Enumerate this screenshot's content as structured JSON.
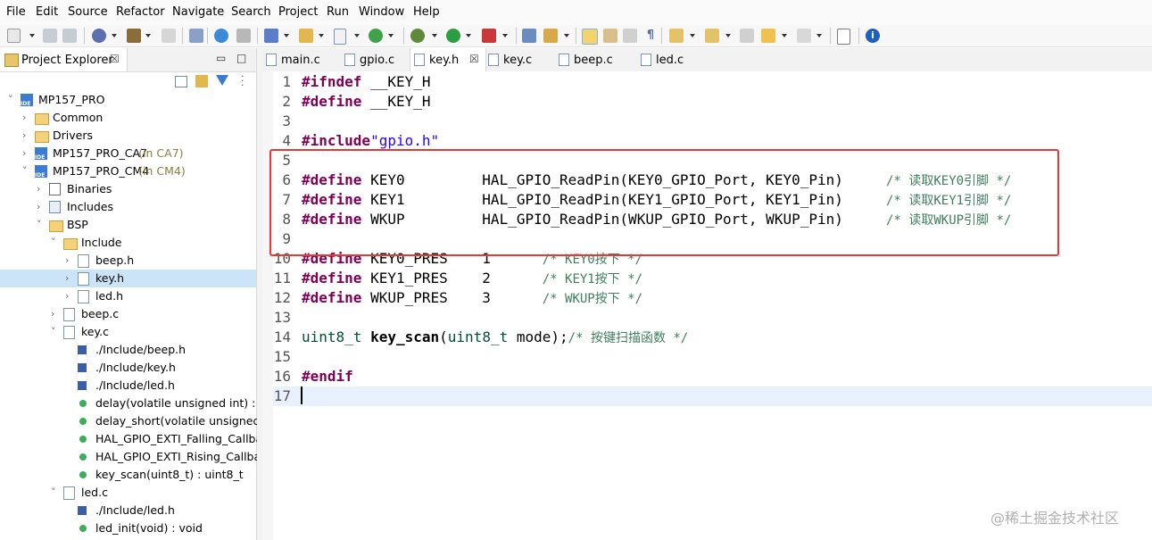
{
  "menubar": [
    "File",
    "Edit",
    "Source",
    "Refactor",
    "Navigate",
    "Search",
    "Project",
    "Run",
    "Window",
    "Help"
  ],
  "explorer": {
    "title": "Project Explorer",
    "tab_close": "☒",
    "minimize": "▭",
    "maximize": "□",
    "tree": [
      {
        "label": "MP157_PRO",
        "suffix": "",
        "icon": "proj",
        "twisty": "˅"
      },
      {
        "label": "Common",
        "suffix": "",
        "icon": "folder",
        "twisty": "›"
      },
      {
        "label": "Drivers",
        "suffix": "",
        "icon": "folder",
        "twisty": "›"
      },
      {
        "label": "MP157_PRO_CA7",
        "suffix": " (in CA7)",
        "icon": "proj",
        "twisty": "›"
      },
      {
        "label": "MP157_PRO_CM4",
        "suffix": " (in CM4)",
        "icon": "proj",
        "twisty": "˅"
      },
      {
        "label": "Binaries",
        "suffix": "",
        "icon": "bin",
        "twisty": "›"
      },
      {
        "label": "Includes",
        "suffix": "",
        "icon": "incl",
        "twisty": "›"
      },
      {
        "label": "BSP",
        "suffix": "",
        "icon": "folder",
        "twisty": "˅"
      },
      {
        "label": "Include",
        "suffix": "",
        "icon": "folder",
        "twisty": "˅"
      },
      {
        "label": "beep.h",
        "suffix": "",
        "icon": "file",
        "twisty": "›"
      },
      {
        "label": "key.h",
        "suffix": "",
        "icon": "file",
        "twisty": "›"
      },
      {
        "label": "led.h",
        "suffix": "",
        "icon": "file",
        "twisty": "›"
      },
      {
        "label": "beep.c",
        "suffix": "",
        "icon": "file",
        "twisty": "›"
      },
      {
        "label": "key.c",
        "suffix": "",
        "icon": "file",
        "twisty": "˅"
      },
      {
        "label": "./Include/beep.h",
        "suffix": "",
        "icon": "inc-ref",
        "twisty": ""
      },
      {
        "label": "./Include/key.h",
        "suffix": "",
        "icon": "inc-ref",
        "twisty": ""
      },
      {
        "label": "./Include/led.h",
        "suffix": "",
        "icon": "inc-ref",
        "twisty": ""
      },
      {
        "label": "delay(volatile unsigned int) : vc",
        "suffix": "",
        "icon": "fn",
        "twisty": ""
      },
      {
        "label": "delay_short(volatile unsigned ir",
        "suffix": "",
        "icon": "fn",
        "twisty": ""
      },
      {
        "label": "HAL_GPIO_EXTI_Falling_Callbac",
        "suffix": "",
        "icon": "fn",
        "twisty": ""
      },
      {
        "label": "HAL_GPIO_EXTI_Rising_Callbac",
        "suffix": "",
        "icon": "fn",
        "twisty": ""
      },
      {
        "label": "key_scan(uint8_t) : uint8_t",
        "suffix": "",
        "icon": "fn",
        "twisty": ""
      },
      {
        "label": "led.c",
        "suffix": "",
        "icon": "file",
        "twisty": "˅"
      },
      {
        "label": "./Include/led.h",
        "suffix": "",
        "icon": "inc-ref",
        "twisty": ""
      },
      {
        "label": "led_init(void) : void",
        "suffix": "",
        "icon": "fn",
        "twisty": ""
      }
    ]
  },
  "editor": {
    "tabs": [
      {
        "label": "main.c",
        "active": false
      },
      {
        "label": "gpio.c",
        "active": false
      },
      {
        "label": "key.h",
        "active": true,
        "close": "☒"
      },
      {
        "label": "key.c",
        "active": false
      },
      {
        "label": "beep.c",
        "active": false
      },
      {
        "label": "led.c",
        "active": false
      }
    ],
    "lines": [
      {
        "n": "1",
        "parts": [
          [
            "kw",
            "#ifndef"
          ],
          [
            "mac",
            " __KEY_H"
          ]
        ]
      },
      {
        "n": "2",
        "parts": [
          [
            "kw",
            "#define"
          ],
          [
            "mac",
            " __KEY_H"
          ]
        ]
      },
      {
        "n": "3",
        "parts": []
      },
      {
        "n": "4",
        "parts": [
          [
            "kw",
            "#include"
          ],
          [
            "str",
            "\"gpio.h\""
          ]
        ]
      },
      {
        "n": "5",
        "parts": []
      },
      {
        "n": "6",
        "parts": [
          [
            "kw",
            "#define"
          ],
          [
            "mac",
            " KEY0         HAL_GPIO_ReadPin(KEY0_GPIO_Port, KEY0_Pin)     "
          ],
          [
            "cm",
            "/* 读取KEY0引脚 */"
          ]
        ]
      },
      {
        "n": "7",
        "parts": [
          [
            "kw",
            "#define"
          ],
          [
            "mac",
            " KEY1         HAL_GPIO_ReadPin(KEY1_GPIO_Port, KEY1_Pin)     "
          ],
          [
            "cm",
            "/* 读取KEY1引脚 */"
          ]
        ]
      },
      {
        "n": "8",
        "parts": [
          [
            "kw",
            "#define"
          ],
          [
            "mac",
            " WKUP         HAL_GPIO_ReadPin(WKUP_GPIO_Port, WKUP_Pin)     "
          ],
          [
            "cm",
            "/* 读取WKUP引脚 */"
          ]
        ]
      },
      {
        "n": "9",
        "parts": []
      },
      {
        "n": "10",
        "parts": [
          [
            "kw",
            "#define"
          ],
          [
            "mac",
            " KEY0_PRES    1      "
          ],
          [
            "cm",
            "/* KEY0按下 */"
          ]
        ]
      },
      {
        "n": "11",
        "parts": [
          [
            "kw",
            "#define"
          ],
          [
            "mac",
            " KEY1_PRES    2      "
          ],
          [
            "cm",
            "/* KEY1按下 */"
          ]
        ]
      },
      {
        "n": "12",
        "parts": [
          [
            "kw",
            "#define"
          ],
          [
            "mac",
            " WKUP_PRES    3      "
          ],
          [
            "cm",
            "/* WKUP按下 */"
          ]
        ]
      },
      {
        "n": "13",
        "parts": []
      },
      {
        "n": "14",
        "parts": [
          [
            "ty",
            "uint8_t"
          ],
          [
            "mac",
            " "
          ],
          [
            "fnb",
            "key_scan"
          ],
          [
            "mac",
            "("
          ],
          [
            "ty",
            "uint8_t"
          ],
          [
            "mac",
            " mode);"
          ],
          [
            "cm",
            "/* 按键扫描函数 */"
          ]
        ]
      },
      {
        "n": "15",
        "parts": []
      },
      {
        "n": "16",
        "parts": [
          [
            "kw",
            "#endif"
          ]
        ]
      },
      {
        "n": "17",
        "parts": []
      }
    ]
  },
  "watermark": "@稀土掘金技术社区",
  "colors": {
    "keyword": "#7f0055",
    "string": "#2a00ff",
    "comment": "#3f7f5f",
    "highlight_box": "#e53935"
  }
}
